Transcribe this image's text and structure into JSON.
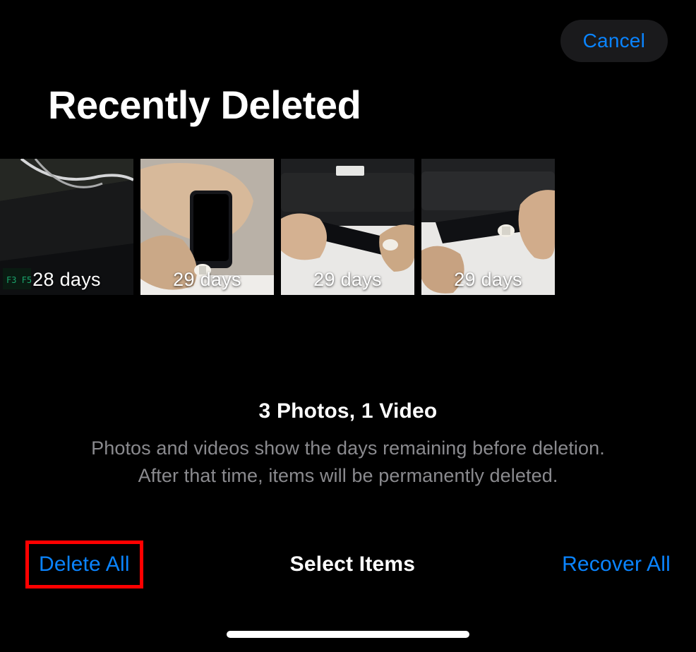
{
  "header": {
    "cancel_label": "Cancel",
    "title": "Recently Deleted"
  },
  "thumbnails": [
    {
      "duration_label": "28 days"
    },
    {
      "duration_label": "29 days"
    },
    {
      "duration_label": "29 days"
    },
    {
      "duration_label": "29 days"
    }
  ],
  "summary": {
    "count_text": "3 Photos, 1 Video",
    "description_line1": "Photos and videos show the days remaining before deletion.",
    "description_line2": "After that time, items will be permanently deleted."
  },
  "footer": {
    "delete_all_label": "Delete All",
    "select_items_label": "Select Items",
    "recover_all_label": "Recover All"
  }
}
